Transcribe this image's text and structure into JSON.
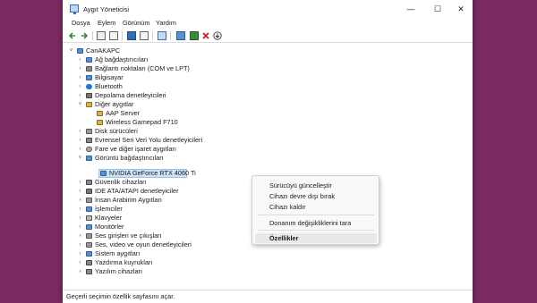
{
  "window": {
    "title": "Aygıt Yöneticisi",
    "controls": {
      "minimize": "—",
      "maximize": "☐",
      "close": "✕"
    }
  },
  "menu": [
    "Dosya",
    "Eylem",
    "Görünüm",
    "Yardım"
  ],
  "tree": {
    "root": "CanAKAPC",
    "categories": [
      "Ağ bağdaştırıcıları",
      "Bağlantı noktaları (COM ve LPT)",
      "Bilgisayar",
      "Bluetooth",
      "Depolama denetleyicileri",
      "Diğer aygıtlar",
      "AAP Server",
      "Wireless Gamepad F710",
      "Disk sürücüleri",
      "Evrensel Seri Veri Yolu denetleyicileri",
      "Fare ve diğer işaret aygıtları",
      "Görüntü bağdaştırıcıları",
      "NVIDIA GeForce RTX 4060 Ti",
      "Güvenlik cihazları",
      "IDE ATA/ATAPI denetleyiciler",
      "İnsan Arabirim Aygıtları",
      "İşlemciler",
      "Klavyeler",
      "Monitörler",
      "Ses girişleri ve çıkışları",
      "Ses, video ve oyun denetleyicileri",
      "Sistem aygıtları",
      "Yazdırma kuyrukları",
      "Yazılım cihazları"
    ]
  },
  "context_menu": {
    "items": [
      "Sürücüyü güncelleştir",
      "Cihazı devre dışı bırak",
      "Cihazı kaldır",
      "Donanım değişikliklerini tara",
      "Özellikler"
    ]
  },
  "status": "Geçerli seçimin özellik sayfasını açar.",
  "colors": {
    "accent": "#2f6fb7",
    "selection": "#cce3f7",
    "background": "#7a2a5e"
  }
}
